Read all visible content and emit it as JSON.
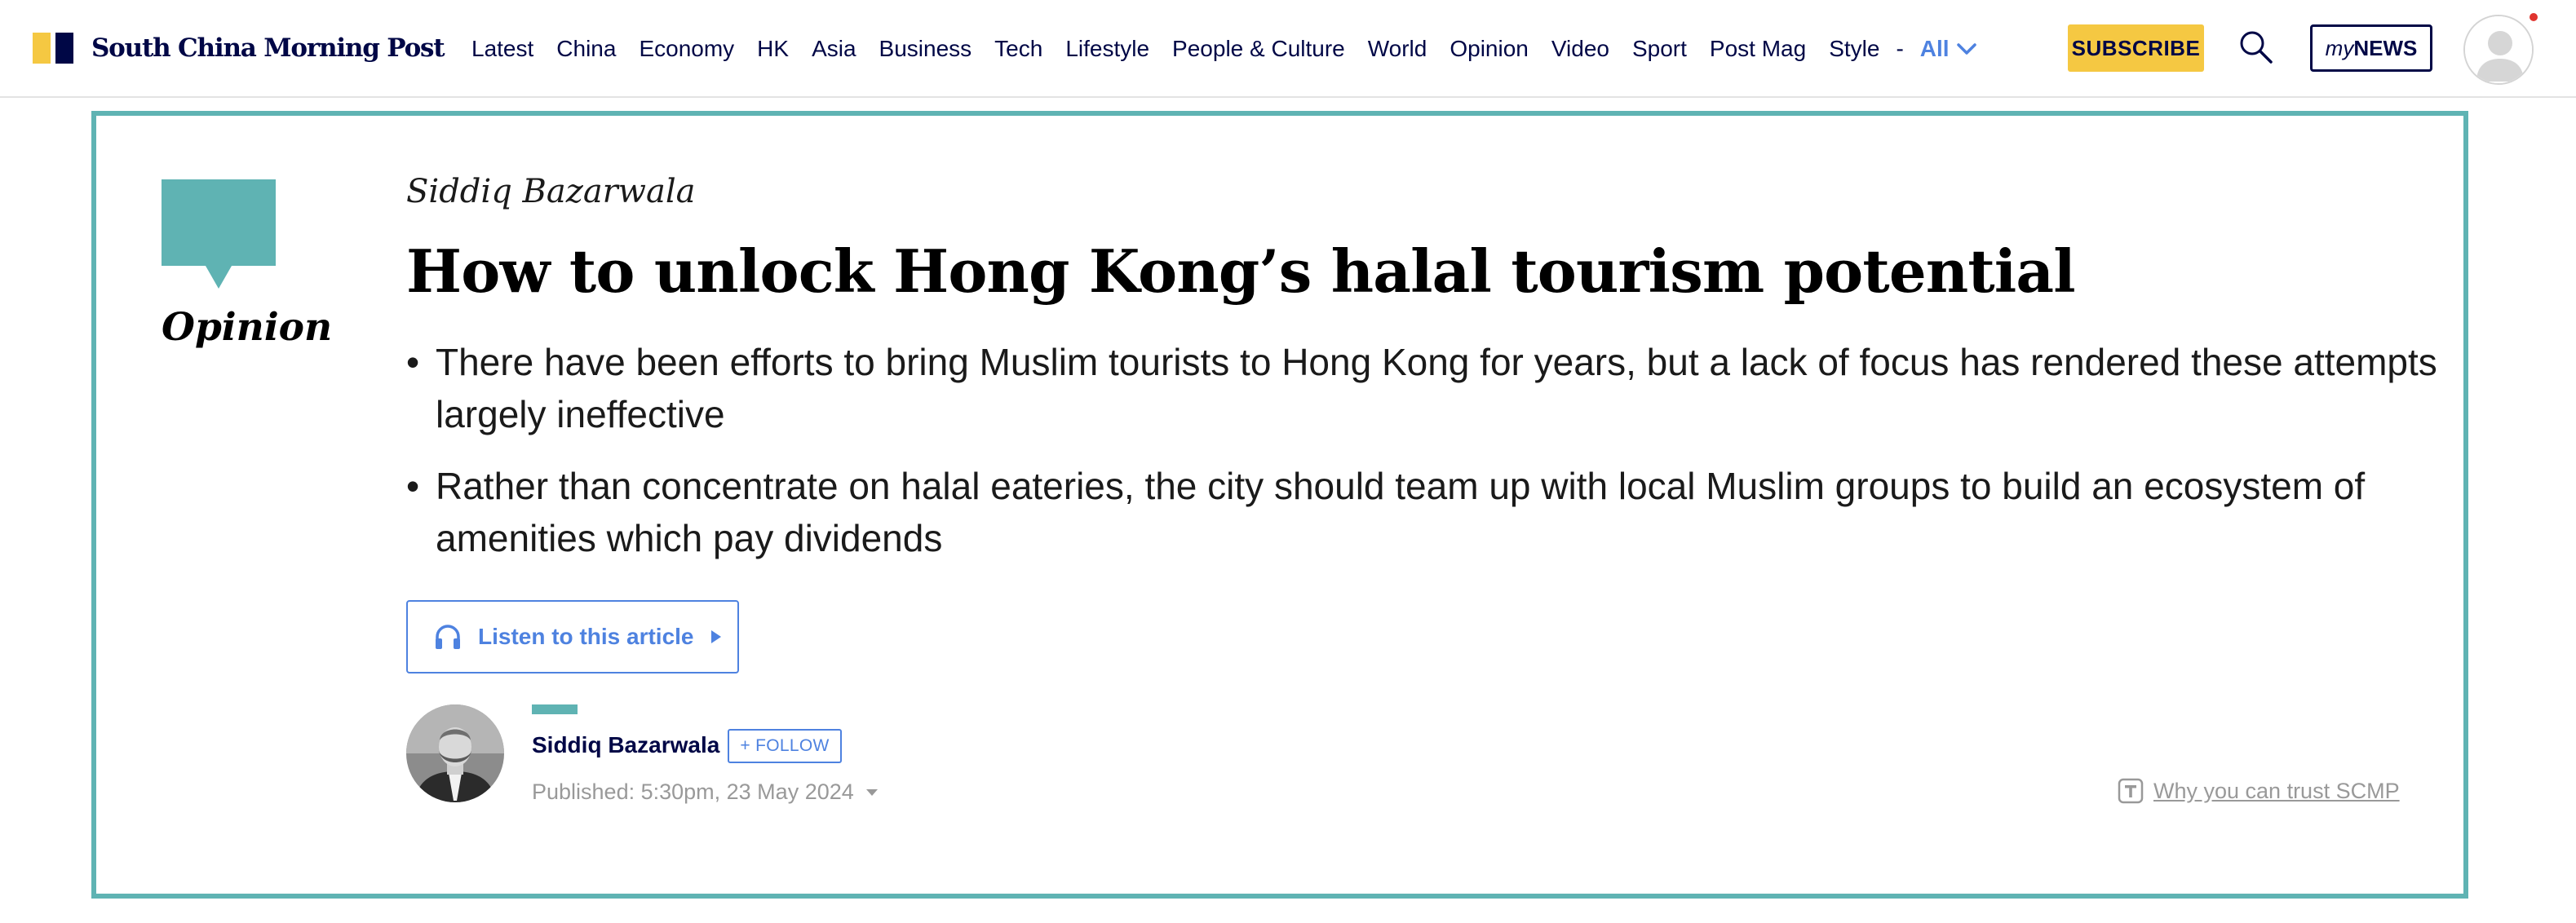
{
  "header": {
    "logo_text": "South China Morning Post",
    "nav_items": [
      "Latest",
      "China",
      "Economy",
      "HK",
      "Asia",
      "Business",
      "Tech",
      "Lifestyle",
      "People & Culture",
      "World",
      "Opinion",
      "Video",
      "Sport",
      "Post Mag",
      "Style"
    ],
    "nav_separator": "-",
    "nav_all_label": "All",
    "subscribe_label": "SUBSCRIBE",
    "mynews_my": "my",
    "mynews_news": "NEWS",
    "icons": {
      "search": "search-icon",
      "all_menu": "chevron-down-icon",
      "profile": "user-avatar-icon"
    }
  },
  "article": {
    "section_label": "Opinion",
    "author_byline": "Siddiq Bazarwala",
    "headline": "How to unlock Hong Kong’s halal tourism potential",
    "bullets": [
      "There have been efforts to bring Muslim tourists to Hong Kong for years, but a lack of focus has rendered these attempts largely ineffective",
      "Rather than concentrate on halal eateries, the city should team up with local Muslim groups to build an ecosystem of amenities which pay dividends"
    ],
    "bullet_marker": "•",
    "listen_label": "Listen to this article",
    "author_name": "Siddiq Bazarwala",
    "follow_label": "+ FOLLOW",
    "published": "Published: 5:30pm, 23 May 2024",
    "trust_label": "Why you can trust SCMP"
  },
  "colors": {
    "brand_navy": "#000746",
    "brand_yellow": "#f5c842",
    "accent_blue": "#4e82e0",
    "opinion_teal": "#5fb3b3",
    "muted_gray": "#999999"
  }
}
